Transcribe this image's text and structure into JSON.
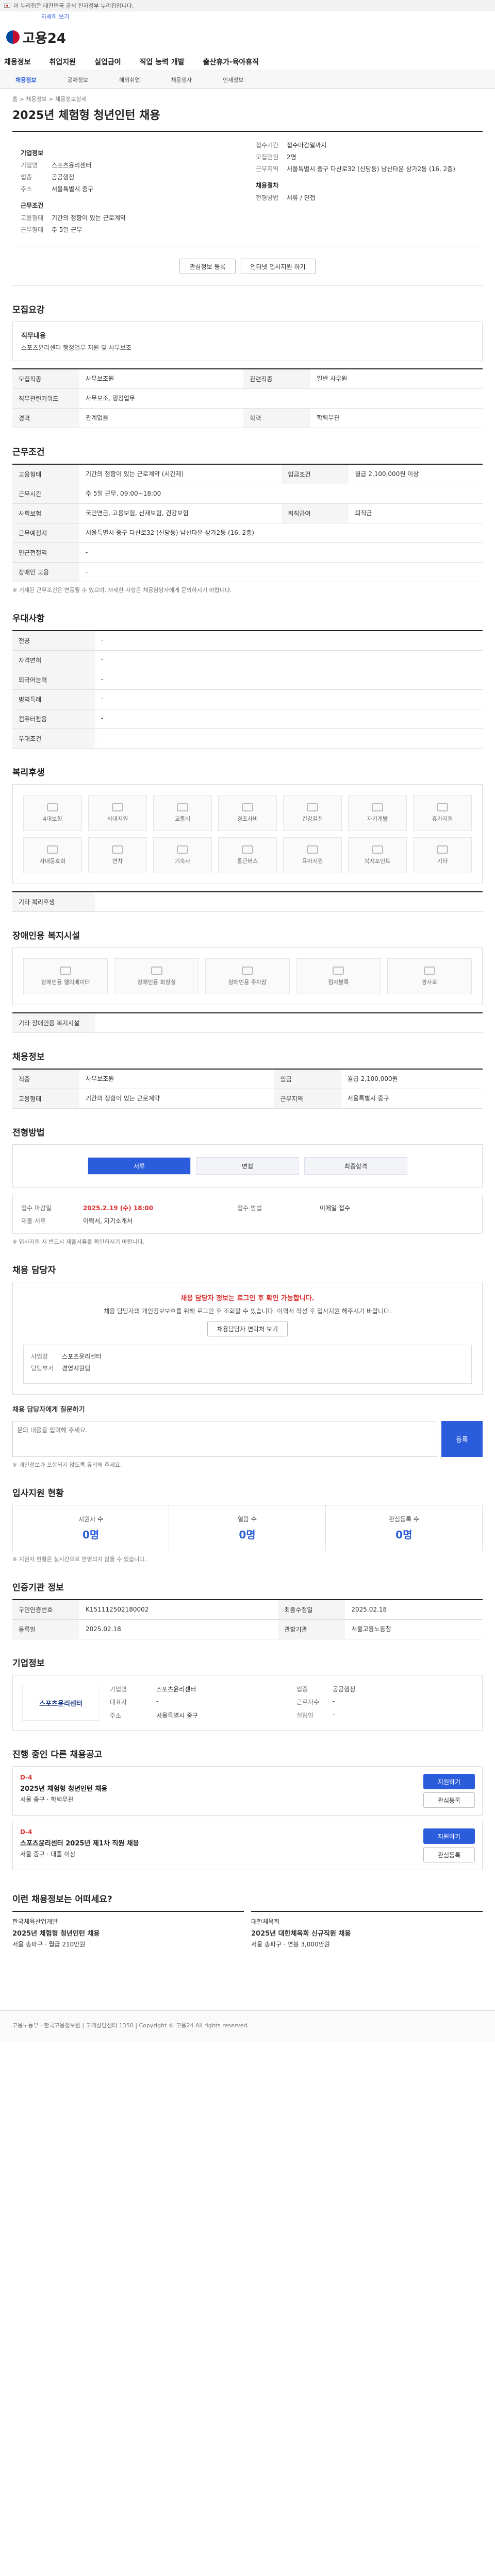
{
  "gov_bar": "이 누리집은 대한민국 공식 전자정부 누리집입니다.",
  "skip": "자세히 보기",
  "logo": "고용24",
  "gnb": [
    "채용정보",
    "취업지원",
    "실업급여",
    "직업 능력 개발",
    "출산휴가·육아휴직"
  ],
  "subnav": [
    "채용정보",
    "공채정보",
    "해외취업",
    "채용행사",
    "인재정보"
  ],
  "breadcrumb": "홈 > 채용정보 > 채용정보상세",
  "title": "2025년 체험형 청년인턴 채용",
  "summary": {
    "company_h": "기업정보",
    "rows_left": [
      {
        "k": "기업명",
        "v": "스포츠윤리센터"
      },
      {
        "k": "업종",
        "v": "공공행정"
      },
      {
        "k": "주소",
        "v": "서울특별시 중구"
      }
    ],
    "cond_h": "근무조건",
    "rows_cond": [
      {
        "k": "고용형태",
        "v": "기간의 정함이 있는 근로계약"
      },
      {
        "k": "근무형태",
        "v": "주 5일 근무"
      }
    ],
    "rows_right": [
      {
        "k": "접수기간",
        "v": "접수마감일까지"
      },
      {
        "k": "모집인원",
        "v": "2명"
      },
      {
        "k": "근무지역",
        "v": "서울특별시 중구 다산로32 (신당동) 남산타운 상가2동 (16, 2층)"
      }
    ],
    "apply_h": "채용절차",
    "rows_apply": [
      {
        "k": "전형방법",
        "v": "서류 / 면접"
      }
    ]
  },
  "buttons": {
    "save": "관심정보 등록",
    "apply": "인터넷 입사지원 하기"
  },
  "sec_job": "모집요강",
  "job_box_title": "직무내용",
  "job_box_text": "스포츠윤리센터 행정업무 지원 및 사무보조",
  "job_rows": [
    {
      "k": "모집직종",
      "v": "사무보조원"
    },
    {
      "k": "관련직종",
      "v": "일반 사무원"
    },
    {
      "k": "직무관련키워드",
      "v": "사무보조, 행정업무"
    },
    {
      "k": "경력",
      "v": "관계없음"
    },
    {
      "k": "학력",
      "v": "학력무관"
    }
  ],
  "sec_cond": "근무조건",
  "cond_rows": [
    {
      "k": "고용형태",
      "v": "기간의 정함이 있는 근로계약 (시간제)"
    },
    {
      "k": "임금조건",
      "v": "월급 2,100,000원 이상"
    },
    {
      "k": "근무시간",
      "v": "주 5일 근무, 09:00~18:00"
    },
    {
      "k": "사회보험",
      "v": "국민연금, 고용보험, 산재보험, 건강보험"
    },
    {
      "k": "퇴직급여",
      "v": "퇴직금"
    },
    {
      "k": "근무예정지",
      "v": "서울특별시 중구 다산로32 (신당동) 남산타운 상가2동 (16, 2층)"
    },
    {
      "k": "인근전철역",
      "v": "-"
    },
    {
      "k": "장애인 고용",
      "v": "-"
    }
  ],
  "cond_note": "※ 기재된 근무조건은 변동될 수 있으며, 자세한 사항은 채용담당자에게 문의하시기 바랍니다.",
  "sec_pref": "우대사항",
  "pref_rows": [
    {
      "k": "전공",
      "v": "-"
    },
    {
      "k": "자격면허",
      "v": "-"
    },
    {
      "k": "외국어능력",
      "v": "-"
    },
    {
      "k": "병역특례",
      "v": "-"
    },
    {
      "k": "컴퓨터활용",
      "v": "-"
    },
    {
      "k": "우대조건",
      "v": "-"
    }
  ],
  "sec_welfare": "복리후생",
  "welfare": [
    "4대보험",
    "식대지원",
    "교통비",
    "경조사비",
    "건강검진",
    "자기계발",
    "휴가지원",
    "사내동호회",
    "연차",
    "기숙사",
    "통근버스",
    "육아지원",
    "복지포인트",
    "기타"
  ],
  "welfare_note": "기타 복리후생",
  "sec_disabled": "장애인용 복지시설",
  "disabled": [
    "장애인용 엘리베이터",
    "장애인용 화장실",
    "장애인용 주차장",
    "점자블록",
    "경사로"
  ],
  "disabled_note": "기타 장애인용 복지시설",
  "sec_rec": "채용정보",
  "rec_rows": [
    {
      "k": "직종",
      "v": "사무보조원"
    },
    {
      "k": "임금",
      "v": "월급 2,100,000원"
    },
    {
      "k": "고용형태",
      "v": "기간의 정함이 있는 근로계약"
    },
    {
      "k": "근무지역",
      "v": "서울특별시 중구"
    }
  ],
  "sec_process": "전형방법",
  "steps": [
    "서류",
    "면접",
    "최종합격"
  ],
  "apply_box": {
    "k1": "접수 마감일",
    "v1": "2025.2.19 (수) 18:00",
    "k2": "접수 방법",
    "v2": "이메일 접수",
    "k3": "제출 서류",
    "v3": "이력서, 자기소개서"
  },
  "process_note": "※ 입사지원 시 반드시 제출서류를 확인하시기 바랍니다.",
  "sec_mgr": "채용 담당자",
  "mgr_alert": "채용 담당자 정보는 로그인 후 확인 가능합니다.",
  "mgr_text": "채용 담당자의 개인정보보호를 위해 로그인 후 조회할 수 있습니다. 이력서 작성 후 입사지원 해주시기 바랍니다.",
  "mgr_btn": "채용담당자 연락처 보기",
  "mgr_k1": "사업장",
  "mgr_v1": "스포츠윤리센터",
  "mgr_k2": "담당부서",
  "mgr_v2": "경영지원팀",
  "q_title": "채용 담당자에게 질문하기",
  "q_placeholder": "문의 내용을 입력해 주세요.",
  "q_btn": "등록",
  "q_note": "※ 개인정보가 포함되지 않도록 유의해 주세요.",
  "sec_stats": "입사지원 현황",
  "stats": [
    {
      "l": "지원자 수",
      "n": "0명"
    },
    {
      "l": "열람 수",
      "n": "0명"
    },
    {
      "l": "관심등록 수",
      "n": "0명"
    }
  ],
  "stats_note": "※ 지원자 현황은 실시간으로 반영되지 않을 수 있습니다.",
  "sec_info": "인증기관 정보",
  "info_rows": [
    {
      "k": "구인인증번호",
      "v": "K151112502180002"
    },
    {
      "k": "최종수정일",
      "v": "2025.02.18"
    },
    {
      "k": "등록일",
      "v": "2025.02.18"
    },
    {
      "k": "관할기관",
      "v": "서울고용노동청"
    }
  ],
  "sec_company": "기업정보",
  "company_logo": "스포츠윤리센터",
  "company_rows": [
    {
      "k": "기업명",
      "v": "스포츠윤리센터"
    },
    {
      "k": "업종",
      "v": "공공행정"
    },
    {
      "k": "대표자",
      "v": "-"
    },
    {
      "k": "근로자수",
      "v": "-"
    },
    {
      "k": "주소",
      "v": "서울특별시 중구"
    },
    {
      "k": "설립일",
      "v": "-"
    }
  ],
  "sec_ads": "진행 중인 다른 채용공고",
  "ads": [
    {
      "d": "D-4",
      "t": "2025년 체험형 청년인턴 채용",
      "m": "서울 중구 · 학력무관",
      "b1": "지원하기",
      "b2": "관심등록"
    },
    {
      "d": "D-4",
      "t": "스포츠윤리센터 2025년 제1차 직원 채용",
      "m": "서울 중구 · 대졸 이상",
      "b1": "지원하기",
      "b2": "관심등록"
    }
  ],
  "sec_recs": "이런 채용정보는 어떠세요?",
  "recs": [
    {
      "c": "한국체육산업개발",
      "t": "2025년 체험형 청년인턴 채용",
      "m": "서울 송파구 · 월급 210만원"
    },
    {
      "c": "대한체육회",
      "t": "2025년 대한체육회 신규직원 채용",
      "m": "서울 송파구 · 연봉 3,000만원"
    }
  ],
  "footer": "고용노동부 · 한국고용정보원 | 고객상담센터 1350 | Copyright © 고용24 All rights reserved."
}
